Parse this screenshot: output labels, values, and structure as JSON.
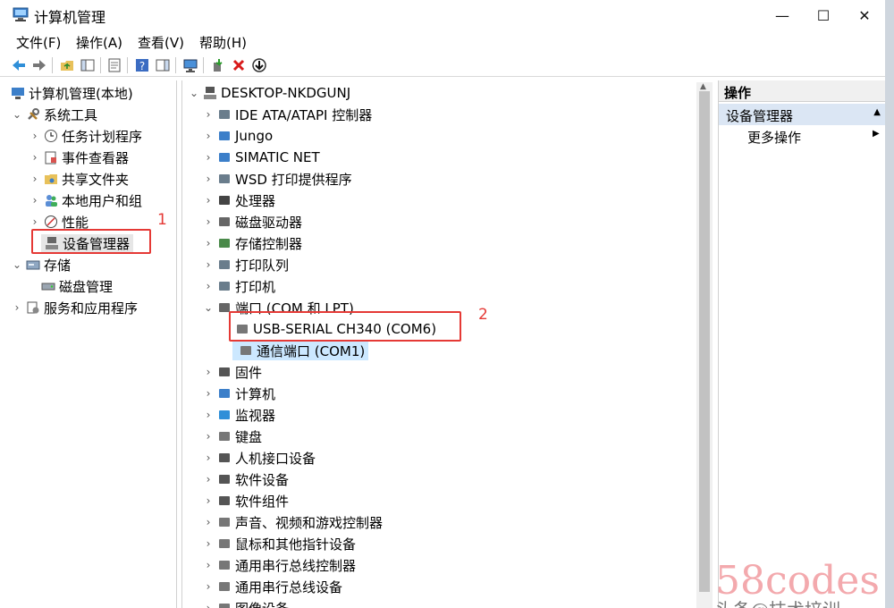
{
  "window": {
    "title": "计算机管理"
  },
  "controls": {
    "minimize": "—",
    "maximize": "☐",
    "close": "✕"
  },
  "menu": [
    {
      "label": "文件(F)"
    },
    {
      "label": "操作(A)"
    },
    {
      "label": "查看(V)"
    },
    {
      "label": "帮助(H)"
    }
  ],
  "left_tree": {
    "root": "计算机管理(本地)",
    "system_tools": "系统工具",
    "task_scheduler": "任务计划程序",
    "event_viewer": "事件查看器",
    "shared_folders": "共享文件夹",
    "local_users": "本地用户和组",
    "performance": "性能",
    "device_manager": "设备管理器",
    "storage": "存储",
    "disk_management": "磁盘管理",
    "services_apps": "服务和应用程序"
  },
  "device_tree": {
    "computer": "DESKTOP-NKDGUNJ",
    "categories": [
      "IDE ATA/ATAPI 控制器",
      "Jungo",
      "SIMATIC NET",
      "WSD 打印提供程序",
      "处理器",
      "磁盘驱动器",
      "存储控制器",
      "打印队列",
      "打印机",
      "端口 (COM 和 LPT)"
    ],
    "port_children": [
      "USB-SERIAL CH340 (COM6)",
      "通信端口 (COM1)"
    ],
    "categories_after": [
      "固件",
      "计算机",
      "监视器",
      "键盘",
      "人机接口设备",
      "软件设备",
      "软件组件",
      "声音、视频和游戏控制器",
      "鼠标和其他指针设备",
      "通用串行总线控制器",
      "通用串行总线设备",
      "图像设备"
    ]
  },
  "actions": {
    "header": "操作",
    "section": "设备管理器",
    "more": "更多操作"
  },
  "annotations": {
    "one": "1",
    "two": "2"
  },
  "watermark": {
    "site": "58codes",
    "line2": "头条@技术培训"
  },
  "colors": {
    "annotation_red": "#e53935",
    "selection_blue": "#cce8ff",
    "section_blue": "#dbe6f4"
  }
}
